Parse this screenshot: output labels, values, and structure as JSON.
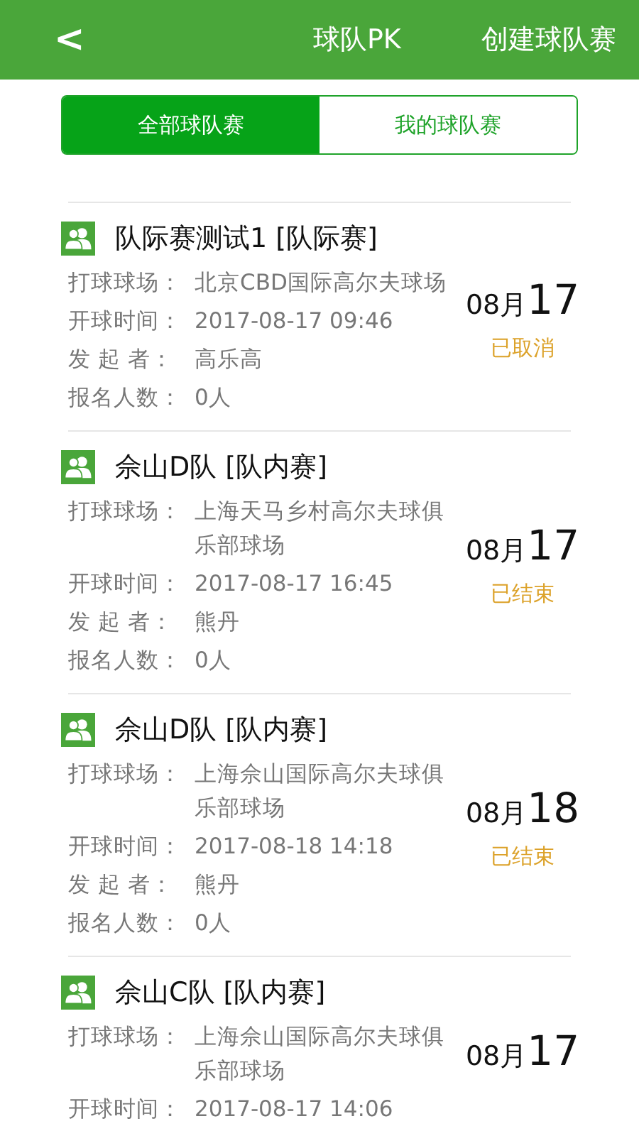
{
  "header": {
    "back": "<",
    "title": "球队PK",
    "action": "创建球队赛"
  },
  "tabs": [
    {
      "label": "全部球队赛",
      "selected": true
    },
    {
      "label": "我的球队赛",
      "selected": false
    }
  ],
  "matches": [
    {
      "title": "队际赛测试1 [队际赛]",
      "fields": [
        {
          "label": "打球球场：",
          "value": "北京CBD国际高尔夫球场"
        },
        {
          "label": "开球时间：",
          "value": "2017-08-17 09:46"
        },
        {
          "label": "发 起 者：",
          "value": "高乐高"
        },
        {
          "label": "报名人数：",
          "value": "0人"
        }
      ],
      "month": "08月",
      "day": "17",
      "status": "已取消"
    },
    {
      "title": "佘山D队 [队内赛]",
      "fields": [
        {
          "label": "打球球场：",
          "value": "上海天马乡村高尔夫球俱乐部球场"
        },
        {
          "label": "开球时间：",
          "value": "2017-08-17 16:45"
        },
        {
          "label": "发 起 者：",
          "value": "熊丹"
        },
        {
          "label": "报名人数：",
          "value": "0人"
        }
      ],
      "month": "08月",
      "day": "17",
      "status": "已结束"
    },
    {
      "title": "佘山D队 [队内赛]",
      "fields": [
        {
          "label": "打球球场：",
          "value": "上海佘山国际高尔夫球俱乐部球场"
        },
        {
          "label": "开球时间：",
          "value": "2017-08-18 14:18"
        },
        {
          "label": "发 起 者：",
          "value": "熊丹"
        },
        {
          "label": "报名人数：",
          "value": "0人"
        }
      ],
      "month": "08月",
      "day": "18",
      "status": "已结束"
    },
    {
      "title": "佘山C队 [队内赛]",
      "fields": [
        {
          "label": "打球球场：",
          "value": "上海佘山国际高尔夫球俱乐部球场"
        },
        {
          "label": "开球时间：",
          "value": "2017-08-17 14:06"
        }
      ],
      "month": "08月",
      "day": "17"
    }
  ]
}
